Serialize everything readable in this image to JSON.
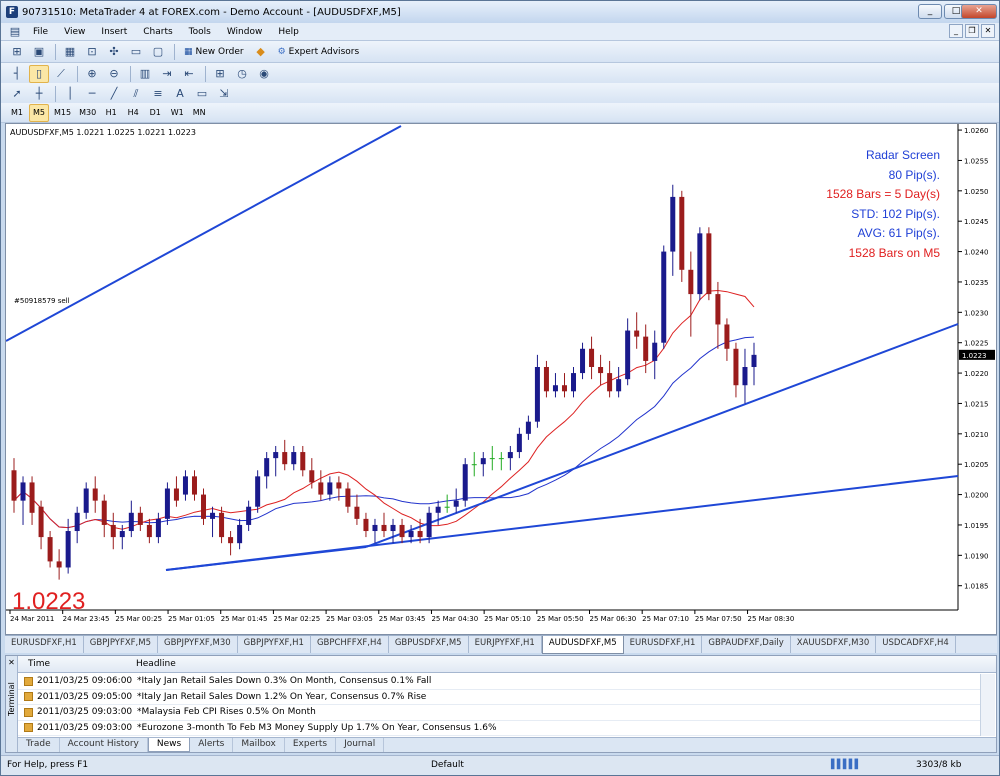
{
  "window": {
    "title": "90731510: MetaTrader 4 at FOREX.com - Demo Account - [AUDUSDFXF,M5]",
    "app_icon_letter": "F"
  },
  "menu": [
    "File",
    "View",
    "Insert",
    "Charts",
    "Tools",
    "Window",
    "Help"
  ],
  "toolbar": {
    "new_order": "New Order",
    "expert_advisors": "Expert Advisors"
  },
  "timeframes": [
    "M1",
    "M5",
    "M15",
    "M30",
    "H1",
    "H4",
    "D1",
    "W1",
    "MN"
  ],
  "active_timeframe": "M5",
  "chart": {
    "header": "AUDUSDFXF,M5  1.0221 1.0225 1.0221 1.0223",
    "order_label": "#50918579 sell",
    "bid_big": "1.0223",
    "current_price": "1.0223",
    "radar": {
      "title": "Radar Screen",
      "pips": "80 Pip(s).",
      "bars_days": "1528 Bars = 5 Day(s)",
      "std": "STD: 102 Pip(s).",
      "avg": "AVG: 61 Pip(s).",
      "bars_tf": "1528 Bars on M5"
    },
    "colors": {
      "bull": "#1a1a8c",
      "bear": "#9b1c1c",
      "doji": "#22aa22",
      "ma_fast": "#dd2222",
      "ma_slow": "#2233cc",
      "trendline": "#1f47d6",
      "radar_blue": "#1f3fd6",
      "radar_red": "#e02020"
    }
  },
  "chart_data": {
    "type": "candlestick",
    "title": "AUDUSDFXF,M5",
    "y_ticks": [
      "1.0260",
      "1.0255",
      "1.0250",
      "1.0245",
      "1.0240",
      "1.0235",
      "1.0230",
      "1.0225",
      "1.0220",
      "1.0215",
      "1.0210",
      "1.0205",
      "1.0200",
      "1.0195",
      "1.0190",
      "1.0185"
    ],
    "x_ticks": [
      "24 Mar 2011",
      "24 Mar 23:45",
      "25 Mar 00:25",
      "25 Mar 01:05",
      "25 Mar 01:45",
      "25 Mar 02:25",
      "25 Mar 03:05",
      "25 Mar 03:45",
      "25 Mar 04:30",
      "25 Mar 05:10",
      "25 Mar 05:50",
      "25 Mar 06:30",
      "25 Mar 07:10",
      "25 Mar 07:50",
      "25 Mar 08:30"
    ],
    "ylim": [
      1.0181,
      1.0261
    ],
    "candles": [
      [
        1.0204,
        1.0206,
        1.0197,
        1.0199
      ],
      [
        1.0199,
        1.0203,
        1.0195,
        1.0202
      ],
      [
        1.0202,
        1.0203,
        1.0195,
        1.0197
      ],
      [
        1.0198,
        1.0199,
        1.0191,
        1.0193
      ],
      [
        1.0193,
        1.0194,
        1.0188,
        1.0189
      ],
      [
        1.0189,
        1.0191,
        1.0186,
        1.0188
      ],
      [
        1.0188,
        1.0196,
        1.0187,
        1.0194
      ],
      [
        1.0194,
        1.0198,
        1.0192,
        1.0197
      ],
      [
        1.0197,
        1.0202,
        1.0196,
        1.0201
      ],
      [
        1.0201,
        1.0203,
        1.0197,
        1.0199
      ],
      [
        1.0199,
        1.02,
        1.0193,
        1.0195
      ],
      [
        1.0195,
        1.0197,
        1.0191,
        1.0193
      ],
      [
        1.0193,
        1.0195,
        1.0191,
        1.0194
      ],
      [
        1.0194,
        1.0199,
        1.0193,
        1.0197
      ],
      [
        1.0197,
        1.0198,
        1.0194,
        1.0195
      ],
      [
        1.0195,
        1.0196,
        1.0192,
        1.0193
      ],
      [
        1.0193,
        1.0197,
        1.0192,
        1.0196
      ],
      [
        1.0196,
        1.0202,
        1.0195,
        1.0201
      ],
      [
        1.0201,
        1.0203,
        1.0198,
        1.0199
      ],
      [
        1.02,
        1.0204,
        1.0199,
        1.0203
      ],
      [
        1.0203,
        1.0204,
        1.0199,
        1.02
      ],
      [
        1.02,
        1.0201,
        1.0195,
        1.0196
      ],
      [
        1.0196,
        1.0198,
        1.0193,
        1.0197
      ],
      [
        1.0197,
        1.0198,
        1.0192,
        1.0193
      ],
      [
        1.0193,
        1.0194,
        1.019,
        1.0192
      ],
      [
        1.0192,
        1.0196,
        1.0191,
        1.0195
      ],
      [
        1.0195,
        1.0199,
        1.0194,
        1.0198
      ],
      [
        1.0198,
        1.0204,
        1.0197,
        1.0203
      ],
      [
        1.0203,
        1.0207,
        1.0201,
        1.0206
      ],
      [
        1.0206,
        1.0208,
        1.0203,
        1.0207
      ],
      [
        1.0207,
        1.0209,
        1.0204,
        1.0205
      ],
      [
        1.0205,
        1.0208,
        1.0204,
        1.0207
      ],
      [
        1.0207,
        1.0208,
        1.0203,
        1.0204
      ],
      [
        1.0204,
        1.0206,
        1.0201,
        1.0202
      ],
      [
        1.0202,
        1.0204,
        1.0199,
        1.02
      ],
      [
        1.02,
        1.0203,
        1.0199,
        1.0202
      ],
      [
        1.0202,
        1.0203,
        1.0199,
        1.0201
      ],
      [
        1.0201,
        1.0202,
        1.0197,
        1.0198
      ],
      [
        1.0198,
        1.02,
        1.0195,
        1.0196
      ],
      [
        1.0196,
        1.0197,
        1.0193,
        1.0194
      ],
      [
        1.0194,
        1.0196,
        1.0192,
        1.0195
      ],
      [
        1.0195,
        1.0197,
        1.0193,
        1.0194
      ],
      [
        1.0194,
        1.0196,
        1.0192,
        1.0195
      ],
      [
        1.0195,
        1.0196,
        1.0192,
        1.0193
      ],
      [
        1.0193,
        1.0195,
        1.0192,
        1.0194
      ],
      [
        1.0194,
        1.0196,
        1.0192,
        1.0193
      ],
      [
        1.0193,
        1.0198,
        1.0192,
        1.0197
      ],
      [
        1.0197,
        1.0199,
        1.0195,
        1.0198
      ],
      [
        1.0198,
        1.02,
        1.0197,
        1.0198
      ],
      [
        1.0198,
        1.0201,
        1.0197,
        1.0199
      ],
      [
        1.0199,
        1.0206,
        1.0198,
        1.0205
      ],
      [
        1.0205,
        1.0207,
        1.0203,
        1.0205
      ],
      [
        1.0205,
        1.0207,
        1.0203,
        1.0206
      ],
      [
        1.0206,
        1.0208,
        1.0204,
        1.0206
      ],
      [
        1.0206,
        1.0207,
        1.0204,
        1.0206
      ],
      [
        1.0206,
        1.0208,
        1.0204,
        1.0207
      ],
      [
        1.0207,
        1.0211,
        1.0206,
        1.021
      ],
      [
        1.021,
        1.0213,
        1.0209,
        1.0212
      ],
      [
        1.0212,
        1.0223,
        1.0211,
        1.0221
      ],
      [
        1.0221,
        1.0222,
        1.0216,
        1.0217
      ],
      [
        1.0217,
        1.022,
        1.0216,
        1.0218
      ],
      [
        1.0218,
        1.022,
        1.0216,
        1.0217
      ],
      [
        1.0217,
        1.0221,
        1.0216,
        1.022
      ],
      [
        1.022,
        1.0225,
        1.0219,
        1.0224
      ],
      [
        1.0224,
        1.0226,
        1.0219,
        1.0221
      ],
      [
        1.0221,
        1.0223,
        1.0218,
        1.022
      ],
      [
        1.022,
        1.0222,
        1.0216,
        1.0217
      ],
      [
        1.0217,
        1.0221,
        1.0216,
        1.0219
      ],
      [
        1.0219,
        1.0229,
        1.0218,
        1.0227
      ],
      [
        1.0227,
        1.023,
        1.0224,
        1.0226
      ],
      [
        1.0226,
        1.0228,
        1.022,
        1.0222
      ],
      [
        1.0222,
        1.0227,
        1.0219,
        1.0225
      ],
      [
        1.0225,
        1.0241,
        1.0224,
        1.024
      ],
      [
        1.024,
        1.0251,
        1.0236,
        1.0249
      ],
      [
        1.0249,
        1.025,
        1.0235,
        1.0237
      ],
      [
        1.0237,
        1.024,
        1.0226,
        1.0233
      ],
      [
        1.0233,
        1.0244,
        1.0232,
        1.0243
      ],
      [
        1.0243,
        1.0244,
        1.0232,
        1.0233
      ],
      [
        1.0233,
        1.0235,
        1.0224,
        1.0228
      ],
      [
        1.0228,
        1.0229,
        1.0222,
        1.0224
      ],
      [
        1.0224,
        1.0225,
        1.0216,
        1.0218
      ],
      [
        1.0218,
        1.0224,
        1.0215,
        1.0221
      ],
      [
        1.0221,
        1.0225,
        1.0218,
        1.0223
      ]
    ]
  },
  "symbol_tabs": [
    "EURUSDFXF,H1",
    "GBPJPYFXF,M5",
    "GBPJPYFXF,M30",
    "GBPJPYFXF,H1",
    "GBPCHFFXF,H4",
    "GBPUSDFXF,M5",
    "EURJPYFXF,H1",
    "AUDUSDFXF,M5",
    "EURUSDFXF,H1",
    "GBPAUDFXF,Daily",
    "XAUUSDFXF,M30",
    "USDCADFXF,H4"
  ],
  "active_symbol_tab": "AUDUSDFXF,M5",
  "terminal": {
    "side_label": "Terminal",
    "col_time": "Time",
    "col_headline": "Headline",
    "rows": [
      {
        "time": "2011/03/25 09:06:00",
        "headline": "*Italy Jan Retail Sales Down 0.3% On Month, Consensus 0.1% Fall"
      },
      {
        "time": "2011/03/25 09:05:00",
        "headline": "*Italy Jan Retail Sales Down 1.2% On Year, Consensus 0.7% Rise"
      },
      {
        "time": "2011/03/25 09:03:00",
        "headline": "*Malaysia Feb CPI Rises 0.5% On Month"
      },
      {
        "time": "2011/03/25 09:03:00",
        "headline": "*Eurozone 3-month To Feb M3 Money Supply Up 1.7% On Year, Consensus 1.6%"
      }
    ],
    "tabs": [
      "Trade",
      "Account History",
      "News",
      "Alerts",
      "Mailbox",
      "Experts",
      "Journal"
    ],
    "active_tab": "News"
  },
  "status": {
    "help": "For Help, press F1",
    "profile": "Default",
    "traffic": "3303/8 kb"
  }
}
